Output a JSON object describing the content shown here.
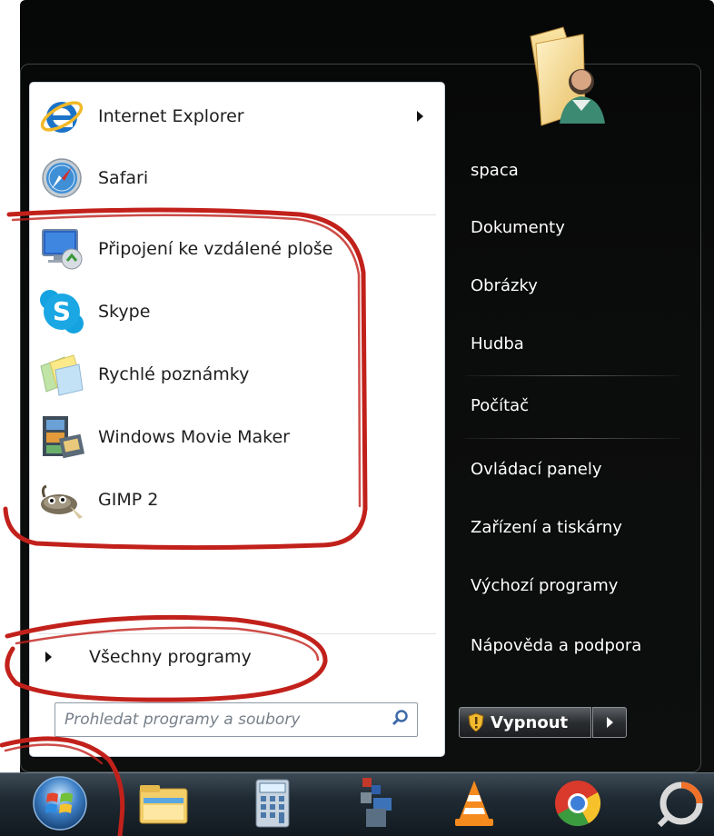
{
  "pinned_programs": [
    {
      "label": "Internet Explorer",
      "icon": "internet-explorer-icon",
      "has_submenu": true
    },
    {
      "label": "Safari",
      "icon": "safari-icon",
      "has_submenu": false
    }
  ],
  "recent_programs": [
    {
      "label": "Připojení ke vzdálené ploše",
      "icon": "remote-desktop-icon"
    },
    {
      "label": "Skype",
      "icon": "skype-icon"
    },
    {
      "label": "Rychlé poznámky",
      "icon": "sticky-notes-icon"
    },
    {
      "label": "Windows Movie Maker",
      "icon": "movie-maker-icon"
    },
    {
      "label": "GIMP 2",
      "icon": "gimp-icon"
    }
  ],
  "all_programs": {
    "label": "Všechny programy"
  },
  "search": {
    "placeholder": "Prohledat programy a soubory"
  },
  "right_pane": {
    "user": "spaca",
    "items": [
      "Dokumenty",
      "Obrázky",
      "Hudba",
      "Počítač",
      "Ovládací panely",
      "Zařízení a tiskárny",
      "Výchozí programy",
      "Nápověda a podpora"
    ]
  },
  "shutdown": {
    "label": "Vypnout"
  },
  "taskbar": {
    "items": [
      "start-orb-icon",
      "windows-explorer-icon",
      "calculator-icon",
      "app-icon",
      "vlc-icon",
      "chrome-icon",
      "app-icon"
    ]
  },
  "colors": {
    "annotation_red": "#c2211b",
    "menu_dark": "#0b0c0c",
    "right_text": "#ffffff"
  }
}
